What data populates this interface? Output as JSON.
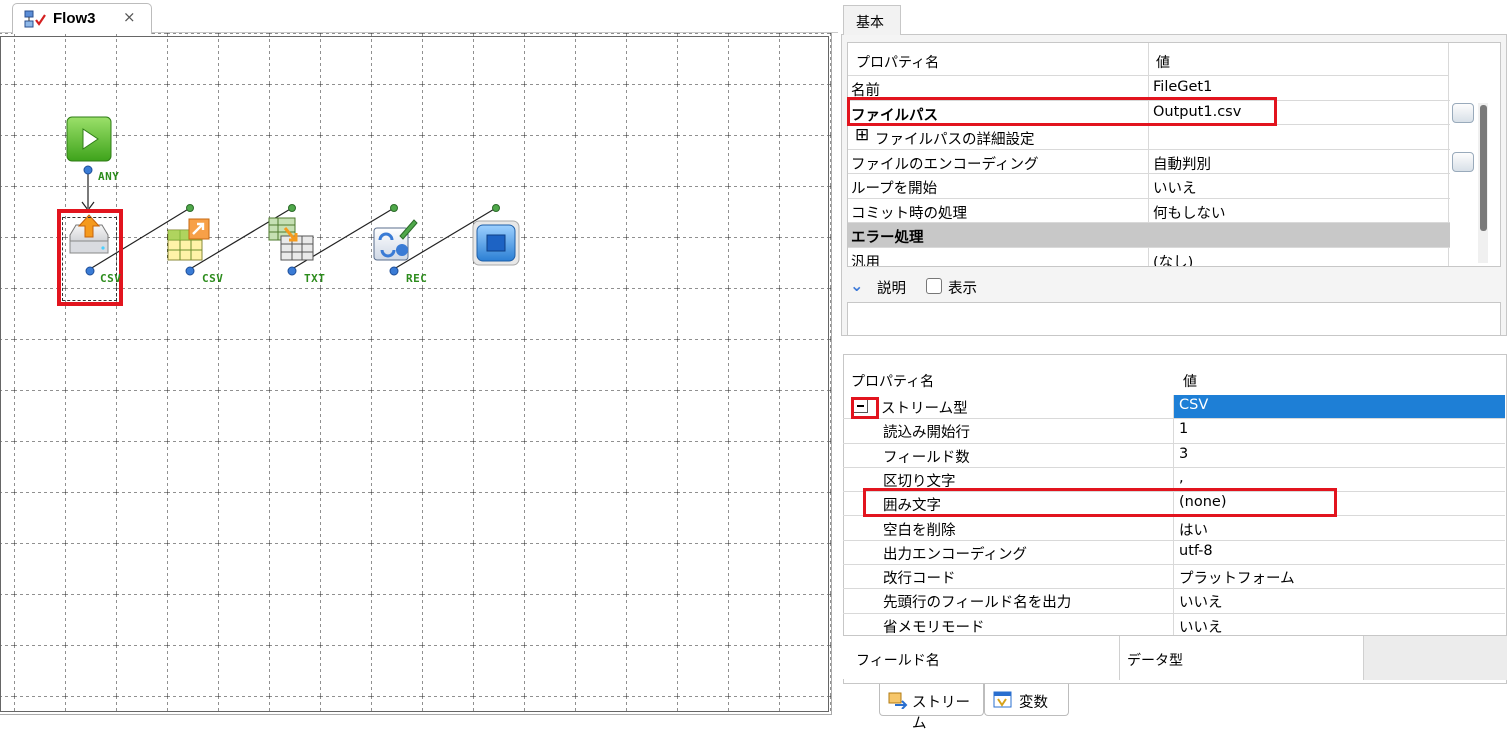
{
  "editor": {
    "tab": {
      "label": "Flow3",
      "icon": "flow-diagram-icon",
      "close": "×"
    },
    "nodes": [
      {
        "name": "start-node",
        "icon": "start-play-icon",
        "port": "ANY"
      },
      {
        "name": "file-get-node",
        "icon": "file-get-icon",
        "port": "CSV"
      },
      {
        "name": "csv-convert-node",
        "icon": "csv-convert-icon",
        "port": "CSV"
      },
      {
        "name": "txt-convert-node",
        "icon": "table-convert-icon",
        "port": "TXT"
      },
      {
        "name": "record-node",
        "icon": "record-edit-icon",
        "port": "REC"
      },
      {
        "name": "end-node",
        "icon": "stop-icon",
        "port": ""
      }
    ]
  },
  "top_panel": {
    "tab_label": "基本",
    "header": {
      "name": "プロパティ名",
      "value": "値"
    },
    "rows": [
      {
        "name": "名前",
        "value": "FileGet1",
        "bold": false
      },
      {
        "name": "ファイルパス",
        "value": "Output1.csv",
        "bold": true
      },
      {
        "name": "ファイルパスの詳細設定",
        "value": "",
        "expand": "⊞"
      },
      {
        "name": "ファイルのエンコーディング",
        "value": "自動判別"
      },
      {
        "name": "ループを開始",
        "value": "いいえ"
      },
      {
        "name": "コミット時の処理",
        "value": "何もしない"
      },
      {
        "name": "エラー処理",
        "value": "",
        "section": true
      },
      {
        "name": "汎用",
        "value": "(なし)"
      }
    ],
    "description": {
      "label": "説明",
      "checkbox_label": "表示",
      "checked": false
    }
  },
  "bottom_panel": {
    "header": {
      "name": "プロパティ名",
      "value": "値"
    },
    "group": {
      "name": "ストリーム型",
      "value": "CSV",
      "collapse": "−"
    },
    "rows": [
      {
        "name": "読込み開始行",
        "value": "1"
      },
      {
        "name": "フィールド数",
        "value": "3"
      },
      {
        "name": "区切り文字",
        "value": ","
      },
      {
        "name": "囲み文字",
        "value": "(none)"
      },
      {
        "name": "空白を削除",
        "value": "はい"
      },
      {
        "name": "出力エンコーディング",
        "value": "utf-8"
      },
      {
        "name": "改行コード",
        "value": "プラットフォーム"
      },
      {
        "name": "先頭行のフィールド名を出力",
        "value": "いいえ"
      },
      {
        "name": "省メモリモード",
        "value": "いいえ"
      }
    ],
    "field_table": {
      "col1": "フィールド名",
      "col2": "データ型"
    },
    "tabs": [
      {
        "label": "ストリーム",
        "icon": "stream-icon"
      },
      {
        "label": "変数",
        "icon": "variable-icon"
      }
    ]
  },
  "colors": {
    "highlight": "#e2141e",
    "selection": "#1e7fd6",
    "port_label": "#2c8c1c",
    "port_dot": "#3a7bd5"
  }
}
